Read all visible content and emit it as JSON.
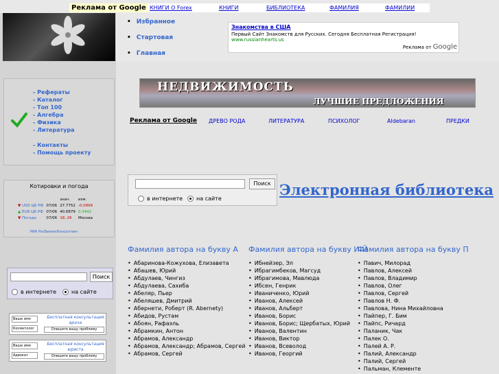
{
  "topbar": {
    "ad_label": "Реклама от Google",
    "links": [
      "КНИГИ О Forex",
      "КНИГИ",
      "БИБЛИОТЕКА",
      "ФАМИЛИЯ",
      "ФАМИЛИИ"
    ]
  },
  "menu1": [
    "Избранное",
    "Стартовая",
    "Главная"
  ],
  "ad": {
    "title": "Знакомства в США",
    "desc": "Первый Сайт Знакомств для Русских. Сегодня Бесплатная Регистрация!",
    "url": "www.russianhearts.us",
    "by": "Реклама от",
    "google": "Google"
  },
  "nav": [
    "- Рефераты",
    "- Каталог",
    "- Топ 100",
    "- Алгебра",
    "- Физика",
    "- Литература",
    "",
    "- Контакты",
    "- Помощь проекту"
  ],
  "quotes": {
    "title": "Котировки и погода",
    "head": [
      "знач.",
      "изм."
    ],
    "rows": [
      [
        "USD ЦБ РФ",
        "07/06",
        "27.7752",
        "-0.0999"
      ],
      [
        "EUR ЦБ РФ",
        "07/06",
        "40.6879",
        "0.3442"
      ],
      [
        "Погода",
        "07/06",
        "18..26",
        "Москва"
      ]
    ],
    "foot": "РИА РосБизнесКонсалтинг"
  },
  "banner": {
    "line1": "НЕДВИЖИМОСТЬ",
    "line2": "ЛУЧШИЕ ПРЕДЛОЖЕНИЯ"
  },
  "links2": {
    "ad": "Реклама от Google",
    "items": [
      "ДРЕВО РОДА",
      "ЛИТЕРАТУРА",
      "ПСИХОЛОГ",
      "Aldebaran",
      "ПРЕДКИ"
    ]
  },
  "search": {
    "button": "Поиск",
    "opt1": "в интернете",
    "opt2": "на сайте"
  },
  "lib_title": "Электронная библиотека",
  "consult1": {
    "l1": "Ваше имя",
    "l2": "Косметолог",
    "title": "Бесплатная консультация врача",
    "tb": "Опишите вашу проблему"
  },
  "consult2": {
    "l1": "Ваше имя",
    "l2": "Адвокат",
    "title": "Бесплатная консультация юриста",
    "tb": "Опишите вашу проблему"
  },
  "columns": [
    {
      "title": "Фамилия автора на букву А",
      "items": [
        "Абаринова-Кожухова, Елизавета",
        "Абашев, Юрий",
        "Абдулаев, Чингиз",
        "Абдулаева, Сахиба",
        "Абеляр, Пьер",
        "Абеляшев, Дмитрий",
        "Абернети, Роберт (R. Abernety)",
        "Абидов, Рустам",
        "Абоян, Рафаэль",
        "Абрамкин, Антон",
        "Абрамов, Александр",
        "Абрамов, Александр; Абрамов, Сергей",
        "Абрамов, Сергей"
      ]
    },
    {
      "title": "Фамилия автора на букву И-Й",
      "items": [
        "Ибнейзер, Эл",
        "Ибрагимбеков, Магсуд",
        "Ибрагимова, Мавлюда",
        "Ибсен, Генрик",
        "Иваниченко, Юрий",
        "Иванов, Алексей",
        "Иванов, Альберт",
        "Иванов, Борис",
        "Иванов, Борис; Щербатых, Юрий",
        "Иванов, Валентин",
        "Иванов, Виктор",
        "Иванов, Всеволод",
        "Иванов, Георгий"
      ]
    },
    {
      "title": "Фамилия автора на букву П",
      "items": [
        "Павич, Милорад",
        "Павлов, Алексей",
        "Павлов, Владимир",
        "Павлов, Олег",
        "Павлов, Сергей",
        "Павлов Н. Ф.",
        "Павлова, Нина Михайловна",
        "Пайпер, Г. Бим",
        "Пайпс, Ричард",
        "Паланик, Чак",
        "Палек О.",
        "Палей А. Р.",
        "Палий, Александр",
        "Палий, Сергей",
        "Пальман, Клементе"
      ]
    }
  ]
}
